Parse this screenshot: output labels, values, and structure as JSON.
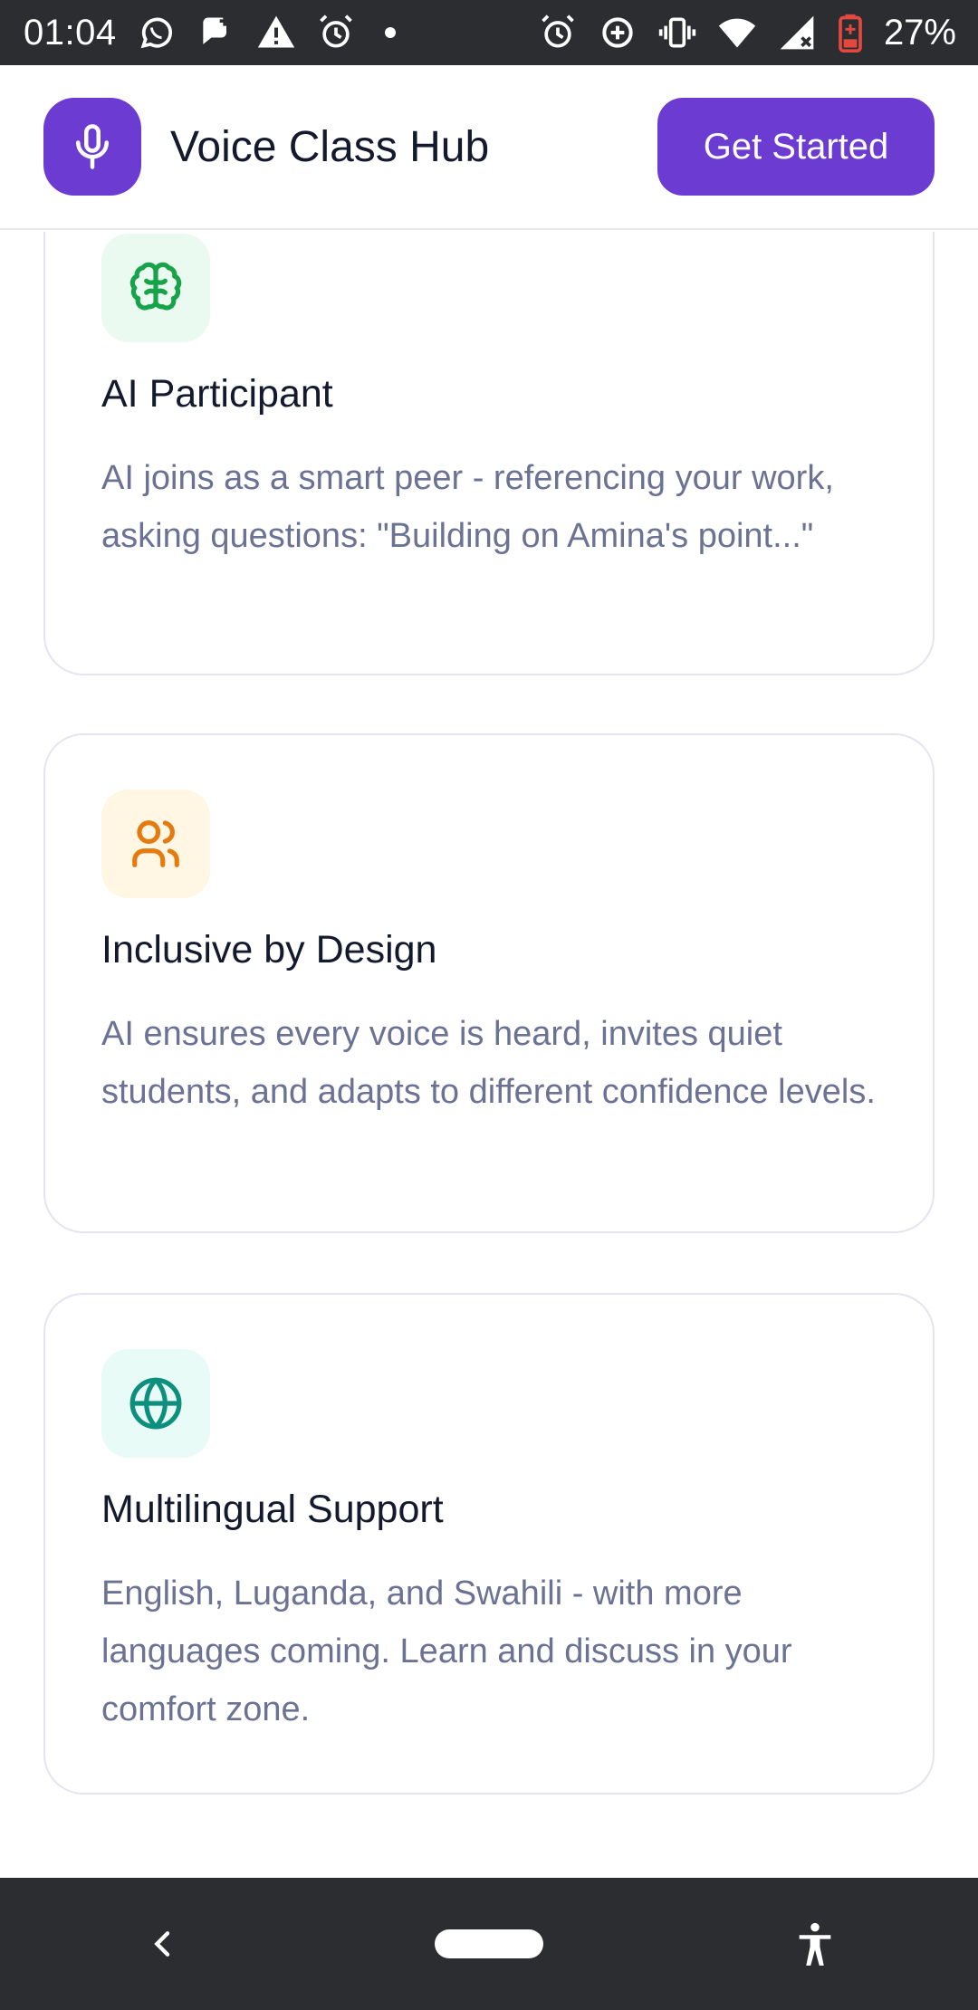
{
  "status_bar": {
    "time": "01:04",
    "battery": "27%"
  },
  "header": {
    "title": "Voice Class Hub",
    "cta_label": "Get Started",
    "brand_color": "#6c3bd1"
  },
  "features": [
    {
      "icon": "brain-icon",
      "icon_color": "#16a34a",
      "icon_bg": "#ebfaf0",
      "title": "AI Participant",
      "description": "AI joins as a smart peer - referencing your work, asking questions: \"Building on Amina's point...\""
    },
    {
      "icon": "users-icon",
      "icon_color": "#e47b0f",
      "icon_bg": "#fff6e3",
      "title": "Inclusive by Design",
      "description": "AI ensures every voice is heard, invites quiet students, and adapts to different confidence levels."
    },
    {
      "icon": "globe-icon",
      "icon_color": "#0d8f7e",
      "icon_bg": "#e9fbf6",
      "title": "Multilingual Support",
      "description": "English, Luganda, and Swahili - with more languages coming. Learn and discuss in your comfort zone."
    }
  ]
}
